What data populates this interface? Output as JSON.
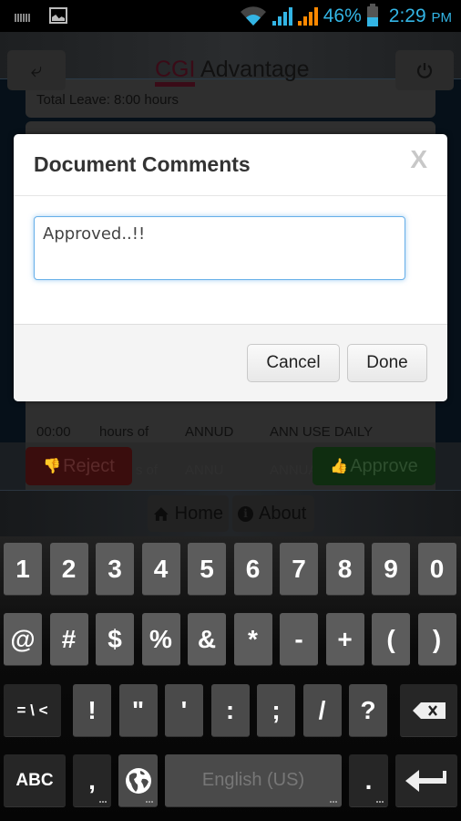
{
  "status_bar": {
    "battery_percent": "46%",
    "battery_level": 0.46,
    "time": "2:29",
    "ampm": "PM",
    "accent_color": "#33b5e5",
    "icons": [
      "keyboard-icon",
      "image-icon",
      "wifi-icon",
      "signal-icon",
      "signal-icon-2",
      "battery-icon"
    ]
  },
  "header": {
    "back_icon": "back-arrow-icon",
    "logo_brand": "CGI",
    "logo_product": " Advantage",
    "power_icon": "power-icon"
  },
  "summary": {
    "total_leave": "Total Leave: 8:00 hours"
  },
  "leave_rows": [
    {
      "hours": "00:00",
      "unit": "hours of",
      "code": "ANNUD",
      "description": "ANN USE DAILY"
    },
    {
      "hours": "",
      "unit": "s of",
      "code": "ANNU",
      "description": "ANNUA"
    }
  ],
  "actions": {
    "reject_label": "Reject",
    "approve_label": "Approve"
  },
  "footer": {
    "home_label": "Home",
    "about_label": "About"
  },
  "modal": {
    "title": "Document Comments",
    "close_label": "X",
    "comment_value": "Approved..!!",
    "cancel_label": "Cancel",
    "done_label": "Done"
  },
  "keyboard": {
    "row1": [
      "1",
      "2",
      "3",
      "4",
      "5",
      "6",
      "7",
      "8",
      "9",
      "0"
    ],
    "row2": [
      "@",
      "#",
      "$",
      "%",
      "&",
      "*",
      "-",
      "+",
      "(",
      ")"
    ],
    "row3_mode": "= \\ <",
    "row3": [
      "!",
      "\"",
      "'",
      ":",
      ";",
      "/",
      "?"
    ],
    "abc_label": "ABC",
    "comma": ",",
    "space_label": "English (US)",
    "period": "."
  }
}
